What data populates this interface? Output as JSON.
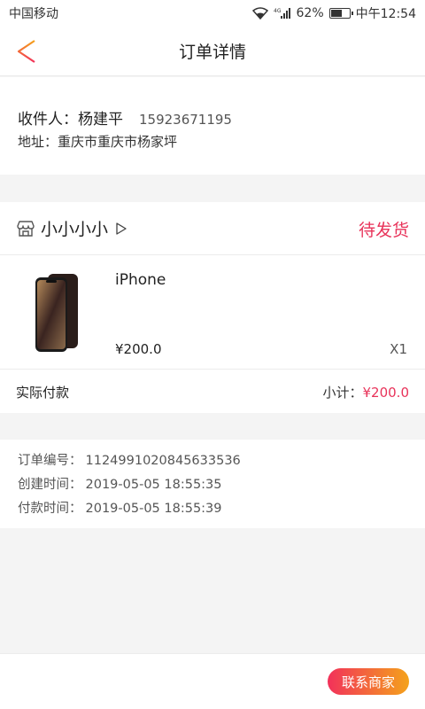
{
  "status_bar": {
    "carrier": "中国移动",
    "network": "4G",
    "battery_percent": "62%",
    "battery_level": 0.62,
    "time": "中午12:54"
  },
  "nav": {
    "title": "订单详情",
    "back_icon": "back-arrow-icon"
  },
  "address": {
    "receiver_label": "收件人：杨建平",
    "phone": "15923671195",
    "address_text": "地址：重庆市重庆市杨家坪"
  },
  "store": {
    "icon": "store-icon",
    "name": "小小小小",
    "arrow_icon": "play-arrow-icon",
    "status": "待发货",
    "status_color": "#e8335a"
  },
  "product": {
    "name": "iPhone",
    "price": "¥200.0",
    "quantity": "X1"
  },
  "payment": {
    "label": "实际付款",
    "subtotal_label": "小计：",
    "subtotal_value": "¥200.0"
  },
  "order_info": {
    "order_no_label": "订单编号：",
    "order_no": "1124991020845633536",
    "created_label": "创建时间：",
    "created": "2019-05-05 18:55:35",
    "paid_label": "付款时间：",
    "paid": "2019-05-05 18:55:39"
  },
  "actions": {
    "contact_label": "联系商家",
    "gradient_start": "#f2315a",
    "gradient_end": "#f4a21b"
  }
}
